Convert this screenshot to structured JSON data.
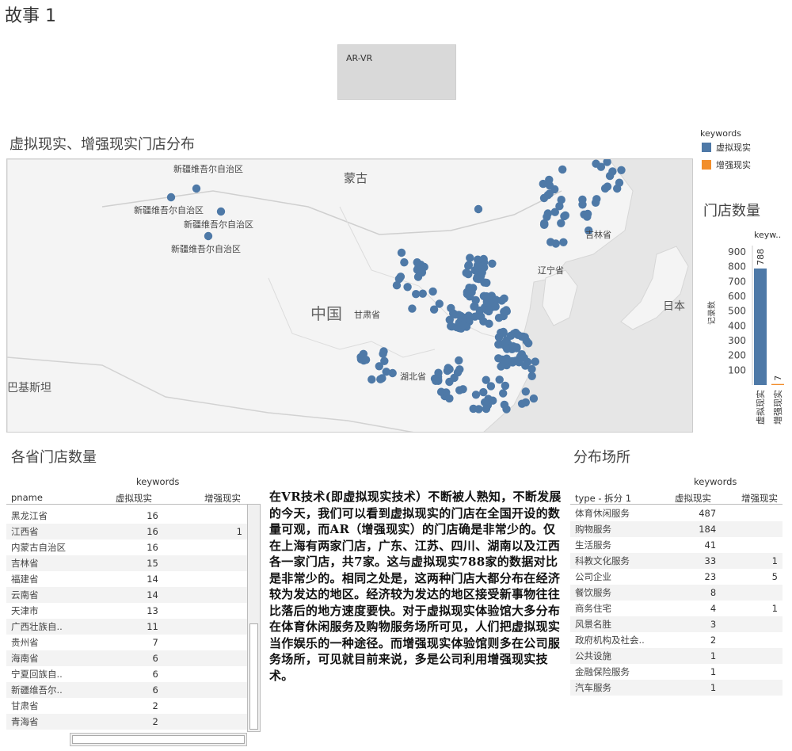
{
  "story": {
    "title": "故事 1"
  },
  "nav": {
    "point_label": "AR-VR"
  },
  "map": {
    "title": "虚拟现实、增强现实门店分布",
    "labels": {
      "mongolia": "蒙古",
      "china": "中国",
      "japan": "日本",
      "pakistan": "巴基斯坦",
      "gansu": "甘肃省",
      "hubei": "湖北省",
      "liaoning": "辽宁省",
      "jilin": "吉林省",
      "xj1": "新疆维吾尔自治区",
      "xj2": "新疆维吾尔自治区",
      "xj3": "新疆维吾尔自治区",
      "xj4": "新疆维吾尔自治区"
    },
    "dot_color": "#4e79a7"
  },
  "legend": {
    "title": "keywords",
    "items": [
      {
        "label": "虚拟现实",
        "color": "#4e79a7"
      },
      {
        "label": "增强现实",
        "color": "#f28e2b"
      }
    ]
  },
  "store_count": {
    "title": "门店数量",
    "header": "keyw..",
    "axis_label": "记录数",
    "chart_data": {
      "type": "bar",
      "categories": [
        "虚拟现实",
        "增强现实"
      ],
      "values": [
        788,
        7
      ],
      "colors": [
        "#4e79a7",
        "#f28e2b"
      ],
      "ylabel": "记录数",
      "ylim": [
        0,
        900
      ],
      "ticks": [
        100,
        200,
        300,
        400,
        500,
        600,
        700,
        800,
        900
      ]
    }
  },
  "province": {
    "title": "各省门店数量",
    "keywords_label": "keywords",
    "col_name": "pname",
    "col_vr": "虚拟现实",
    "col_ar": "增强现实",
    "rows": [
      {
        "name": "黑龙江省",
        "vr": "16",
        "ar": ""
      },
      {
        "name": "江西省",
        "vr": "16",
        "ar": "1"
      },
      {
        "name": "内蒙古自治区",
        "vr": "16",
        "ar": ""
      },
      {
        "name": "吉林省",
        "vr": "15",
        "ar": ""
      },
      {
        "name": "福建省",
        "vr": "14",
        "ar": ""
      },
      {
        "name": "云南省",
        "vr": "14",
        "ar": ""
      },
      {
        "name": "天津市",
        "vr": "13",
        "ar": ""
      },
      {
        "name": "广西壮族自..",
        "vr": "11",
        "ar": ""
      },
      {
        "name": "贵州省",
        "vr": "7",
        "ar": ""
      },
      {
        "name": "海南省",
        "vr": "6",
        "ar": ""
      },
      {
        "name": "宁夏回族自..",
        "vr": "6",
        "ar": ""
      },
      {
        "name": "新疆维吾尔..",
        "vr": "6",
        "ar": ""
      },
      {
        "name": "甘肃省",
        "vr": "2",
        "ar": ""
      },
      {
        "name": "青海省",
        "vr": "2",
        "ar": ""
      }
    ]
  },
  "narrative": {
    "text": "在VR技术(即虚拟现实技术）不断被人熟知，不断发展的今天，我们可以看到虚拟现实的门店在全国开设的数量可观，而AR（增强现实）的门店确是非常少的。仅在上海有两家门店，广东、江苏、四川、湖南以及江西各一家门店，共7家。这与虚拟现实788家的数据对比是非常少的。相同之处是，这两种门店大都分布在经济较为发达的地区。经济较为发达的地区接受新事物往往比落后的地方速度要快。对于虚拟现实体验馆大多分布在体育休闲服务及购物服务场所可见，人们把虚拟现实当作娱乐的一种途径。而增强现实体验馆则多在公司服务场所，可见就目前来说，多是公司利用增强现实技术。"
  },
  "venue": {
    "title": "分布场所",
    "keywords_label": "keywords",
    "col_type": "type - 拆分 1",
    "col_vr": "虚拟现实",
    "col_ar": "增强现实",
    "rows": [
      {
        "name": "体育休闲服务",
        "vr": "487",
        "ar": ""
      },
      {
        "name": "购物服务",
        "vr": "184",
        "ar": ""
      },
      {
        "name": "生活服务",
        "vr": "41",
        "ar": ""
      },
      {
        "name": "科教文化服务",
        "vr": "33",
        "ar": "1"
      },
      {
        "name": "公司企业",
        "vr": "23",
        "ar": "5"
      },
      {
        "name": "餐饮服务",
        "vr": "8",
        "ar": ""
      },
      {
        "name": "商务住宅",
        "vr": "4",
        "ar": "1"
      },
      {
        "name": "风景名胜",
        "vr": "3",
        "ar": ""
      },
      {
        "name": "政府机构及社会..",
        "vr": "2",
        "ar": ""
      },
      {
        "name": "公共设施",
        "vr": "1",
        "ar": ""
      },
      {
        "name": "金融保险服务",
        "vr": "1",
        "ar": ""
      },
      {
        "name": "汽车服务",
        "vr": "1",
        "ar": ""
      }
    ]
  }
}
